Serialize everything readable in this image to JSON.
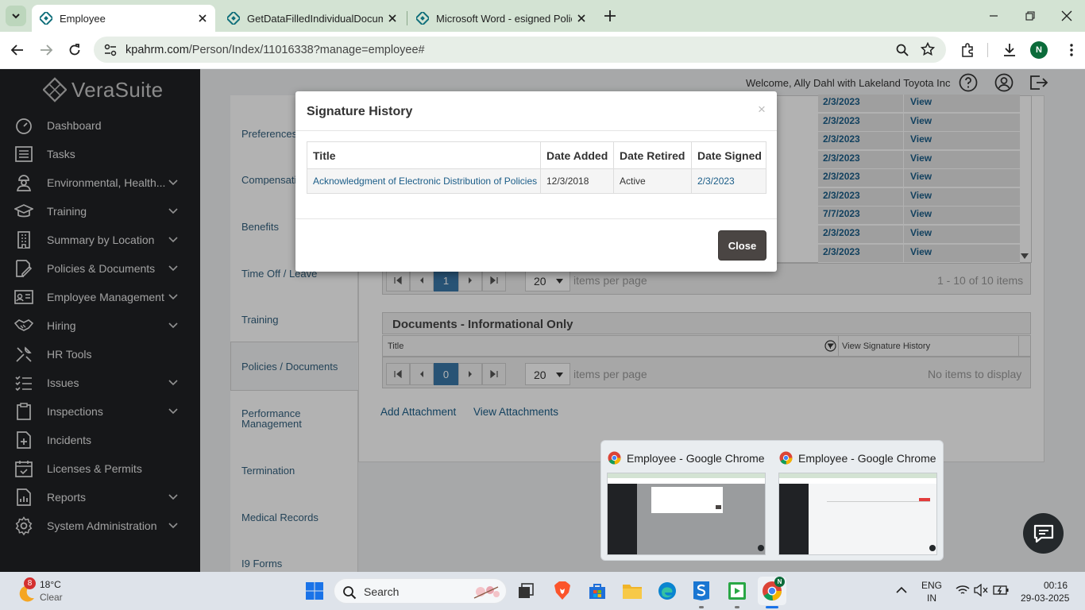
{
  "browser": {
    "tabs": [
      {
        "title": "Employee",
        "active": true
      },
      {
        "title": "GetDataFilledIndividualDocume",
        "active": false
      },
      {
        "title": "Microsoft Word - esigned Policy",
        "active": false
      }
    ],
    "url_host": "kpahrm.com",
    "url_path": "/Person/Index/11016338?manage=employee#",
    "profile_initial": "N"
  },
  "app": {
    "brand": "VeraSuite",
    "welcome": "Welcome, Ally Dahl with Lakeland Toyota Inc"
  },
  "sidebar": {
    "items": [
      {
        "label": "Dashboard",
        "icon": "dashboard-icon",
        "has_children": false
      },
      {
        "label": "Tasks",
        "icon": "tasks-list-icon",
        "has_children": false
      },
      {
        "label": "Environmental, Health...",
        "icon": "person-safety-icon",
        "has_children": true
      },
      {
        "label": "Training",
        "icon": "graduation-cap-icon",
        "has_children": true
      },
      {
        "label": "Summary by Location",
        "icon": "building-icon",
        "has_children": true
      },
      {
        "label": "Policies & Documents",
        "icon": "document-edit-icon",
        "has_children": true
      },
      {
        "label": "Employee Management",
        "icon": "id-card-icon",
        "has_children": true
      },
      {
        "label": "Hiring",
        "icon": "handshake-icon",
        "has_children": true
      },
      {
        "label": "HR Tools",
        "icon": "tools-icon",
        "has_children": false
      },
      {
        "label": "Issues",
        "icon": "issues-list-icon",
        "has_children": true
      },
      {
        "label": "Inspections",
        "icon": "clipboard-icon",
        "has_children": true
      },
      {
        "label": "Incidents",
        "icon": "medical-file-icon",
        "has_children": false
      },
      {
        "label": "Licenses & Permits",
        "icon": "calendar-check-icon",
        "has_children": false
      },
      {
        "label": "Reports",
        "icon": "report-chart-icon",
        "has_children": true
      },
      {
        "label": "System Administration",
        "icon": "gear-icon",
        "has_children": true
      }
    ]
  },
  "left_nav": {
    "items": [
      {
        "label": "Preferences",
        "active": false
      },
      {
        "label": "Compensation",
        "active": false
      },
      {
        "label": "Benefits",
        "active": false
      },
      {
        "label": "Time Off / Leave",
        "active": false
      },
      {
        "label": "Training",
        "active": false
      },
      {
        "label": "Policies / Documents",
        "active": true
      },
      {
        "label": "Performance\nManagement",
        "active": false
      },
      {
        "label": "Termination",
        "active": false
      },
      {
        "label": "Medical Records",
        "active": false
      },
      {
        "label": "I9 Forms",
        "active": false
      }
    ]
  },
  "policies_grid": {
    "rows": [
      {
        "date_signed": "2/3/2023",
        "action": "View"
      },
      {
        "date_signed": "2/3/2023",
        "action": "View"
      },
      {
        "date_signed": "2/3/2023",
        "action": "View"
      },
      {
        "date_signed": "2/3/2023",
        "action": "View"
      },
      {
        "date_signed": "2/3/2023",
        "action": "View"
      },
      {
        "date_signed": "2/3/2023",
        "action": "View"
      },
      {
        "date_signed": "7/7/2023",
        "action": "View"
      },
      {
        "date_signed": "2/3/2023",
        "action": "View"
      },
      {
        "date_signed": "2/3/2023",
        "action": "View"
      }
    ],
    "pager": {
      "page": "1",
      "page_size": "20",
      "items_per_page": "items per page",
      "info": "1 - 10 of 10 items"
    }
  },
  "documents_grid": {
    "title": "Documents - Informational Only",
    "columns": [
      "Title",
      "View Signature History"
    ],
    "pager": {
      "page": "0",
      "page_size": "20",
      "items_per_page": "items per page",
      "info": "No items to display"
    }
  },
  "links": {
    "add_attachment": "Add Attachment",
    "view_attachments": "View Attachments"
  },
  "modal": {
    "title": "Signature History",
    "close_x": "×",
    "columns": [
      "Title",
      "Date Added",
      "Date Retired",
      "Date Signed"
    ],
    "rows": [
      {
        "title": "Acknowledgment of Electronic Distribution of Policies",
        "date_added": "12/3/2018",
        "date_retired": "Active",
        "date_signed": "2/3/2023"
      }
    ],
    "close_button": "Close"
  },
  "taskbar_preview": {
    "windows": [
      {
        "title": "Employee - Google Chrome"
      },
      {
        "title": "Employee - Google Chrome"
      }
    ]
  },
  "taskbar": {
    "weather": {
      "badge": "8",
      "temp": "18°C",
      "condition": "Clear"
    },
    "search_placeholder": "Search",
    "language": "ENG",
    "region": "IN",
    "time": "00:16",
    "date": "29-03-2025"
  },
  "colors": {
    "sidebar_bg": "#202225",
    "link": "#1b5d88",
    "pager_active": "#3a78a8",
    "tab_strip": "#d3e3d3"
  }
}
